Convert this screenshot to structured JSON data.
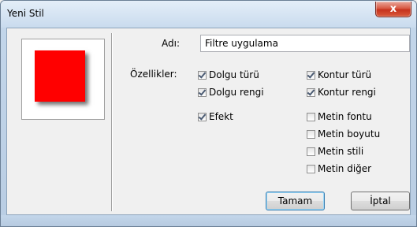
{
  "window": {
    "title": "Yeni Stil",
    "close_glyph": "x"
  },
  "preview": {
    "swatch_color": "#ff0000"
  },
  "form": {
    "name_label": "Adı:",
    "name_value": "Filtre uygulama",
    "properties_label": "Özellikler:"
  },
  "checkboxes": {
    "dolgu_turu": {
      "label": "Dolgu türü",
      "checked": true
    },
    "dolgu_rengi": {
      "label": "Dolgu rengi",
      "checked": true
    },
    "efekt": {
      "label": "Efekt",
      "checked": true
    },
    "kontur_turu": {
      "label": "Kontur türü",
      "checked": true
    },
    "kontur_rengi": {
      "label": "Kontur rengi",
      "checked": true
    },
    "metin_fontu": {
      "label": "Metin fontu",
      "checked": false
    },
    "metin_boyutu": {
      "label": "Metin boyutu",
      "checked": false
    },
    "metin_stili": {
      "label": "Metin stili",
      "checked": false
    },
    "metin_diger": {
      "label": "Metin diğer",
      "checked": false
    }
  },
  "buttons": {
    "ok": "Tamam",
    "cancel": "İptal"
  }
}
